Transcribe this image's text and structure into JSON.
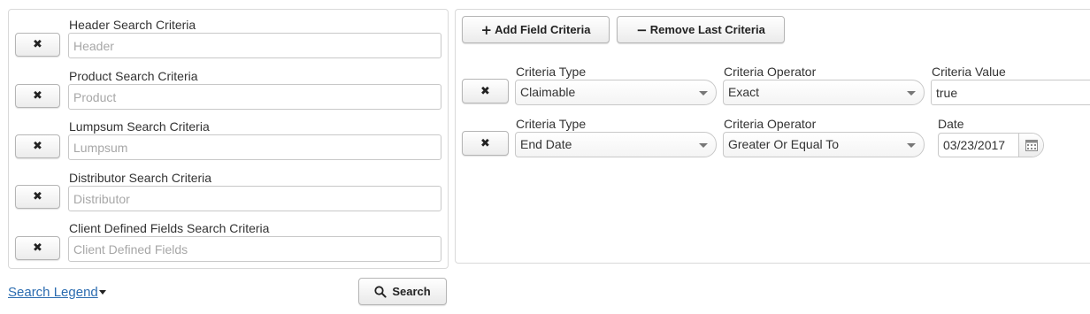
{
  "left_panel": {
    "rows": [
      {
        "label": "Header Search Criteria",
        "placeholder": "Header",
        "remove": "✖"
      },
      {
        "label": "Product Search Criteria",
        "placeholder": "Product",
        "remove": "✖"
      },
      {
        "label": "Lumpsum Search Criteria",
        "placeholder": "Lumpsum",
        "remove": "✖"
      },
      {
        "label": "Distributor Search Criteria",
        "placeholder": "Distributor",
        "remove": "✖"
      },
      {
        "label": "Client Defined Fields Search Criteria",
        "placeholder": "Client Defined Fields",
        "remove": "✖"
      }
    ]
  },
  "toolbar": {
    "add_label": "Add Field Criteria",
    "add_icon": "plus-icon",
    "add_symbol": "+",
    "remove_label": "Remove Last Criteria",
    "remove_icon": "minus-icon",
    "remove_symbol": "−"
  },
  "criteria_rows": [
    {
      "remove": "✖",
      "type_label": "Criteria Type",
      "type_value": "Claimable",
      "operator_label": "Criteria Operator",
      "operator_value": "Exact",
      "value_label": "Criteria Value",
      "value": "true"
    },
    {
      "remove": "✖",
      "type_label": "Criteria Type",
      "type_value": "End Date",
      "operator_label": "Criteria Operator",
      "operator_value": "Greater Or Equal To",
      "value_label": "Date",
      "value": "03/23/2017"
    }
  ],
  "footer": {
    "legend_link": "Search Legend",
    "search_button": "Search",
    "search_icon": "magnifier-icon"
  },
  "colors": {
    "link": "#2b6cb0",
    "border": "#c8c8c8",
    "placeholder": "#a7a7a7"
  }
}
